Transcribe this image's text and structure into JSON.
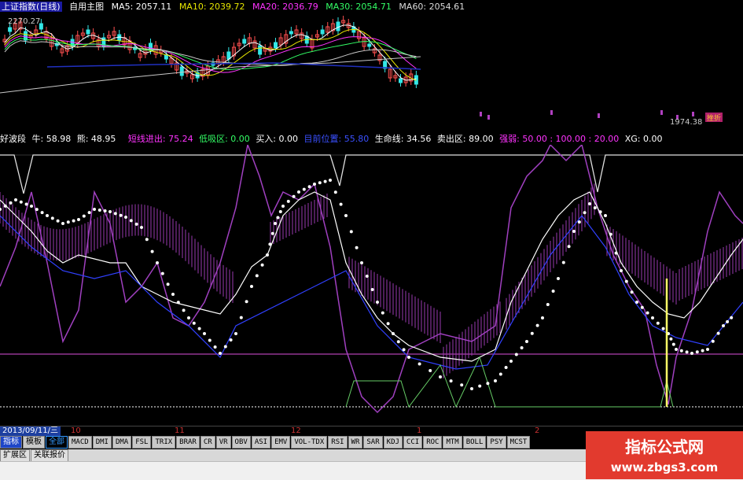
{
  "colors": {
    "ma5": "#ffffff",
    "ma10": "#e6e600",
    "ma20": "#ff33ff",
    "ma30": "#33ff66",
    "ma60": "#c8c8c8",
    "up_candle": "#ff5050",
    "down_candle": "#33e6e6",
    "purple_line": "#a040c0",
    "white_line": "#ffffff",
    "dots": "#ffffff",
    "blue_line": "#3040ff",
    "yellow_bar": "#ffff66",
    "green_line": "#66cc66",
    "tab_active": "#1e46c8"
  },
  "main_header": {
    "title": "上证指数(日线)",
    "mode": "自用主图",
    "ma5": "MA5: 2057.11",
    "ma10": "MA10: 2039.72",
    "ma20": "MA20: 2036.79",
    "ma30": "MA30: 2054.71",
    "ma60": "MA60: 2054.61",
    "high_label": "2270.27",
    "low_label": "1974.38",
    "event_tag": "挫折"
  },
  "indicator_header": {
    "name": "好波段",
    "bull": "牛: 58.98",
    "bear": "熊: 48.95",
    "items": [
      {
        "text": "短线进出: 75.24",
        "color": "#ff33ff"
      },
      {
        "text": "低吸区: 0.00",
        "color": "#33ff66"
      },
      {
        "text": "买入: 0.00",
        "color": "#ffffff"
      },
      {
        "text": "目前位置: 55.80",
        "color": "#3a50ff"
      },
      {
        "text": "生命线: 34.56",
        "color": "#ffffff"
      },
      {
        "text": "卖出区: 89.00",
        "color": "#ffffff"
      },
      {
        "text": "强弱: 50.00 : 100.00 : 20.00",
        "color": "#ff33ff"
      },
      {
        "text": "XG: 0.00",
        "color": "#ffffff"
      }
    ]
  },
  "axis": {
    "date": "2013/09/11/三",
    "ticks": [
      "10",
      "11",
      "12",
      "1",
      "2"
    ]
  },
  "tabs": [
    "指标",
    "模板",
    "全部",
    "MACD",
    "DMI",
    "DMA",
    "FSL",
    "TRIX",
    "BRAR",
    "CR",
    "VR",
    "OBV",
    "ASI",
    "EMV",
    "VOL-TDX",
    "RSI",
    "WR",
    "SAR",
    "KDJ",
    "CCI",
    "ROC",
    "MTM",
    "BOLL",
    "PSY",
    "MCST"
  ],
  "tabs2": [
    "扩展区",
    "关联报价"
  ],
  "watermark": {
    "line1": "指标公式网",
    "line2": "www.zbgs3.com"
  }
}
